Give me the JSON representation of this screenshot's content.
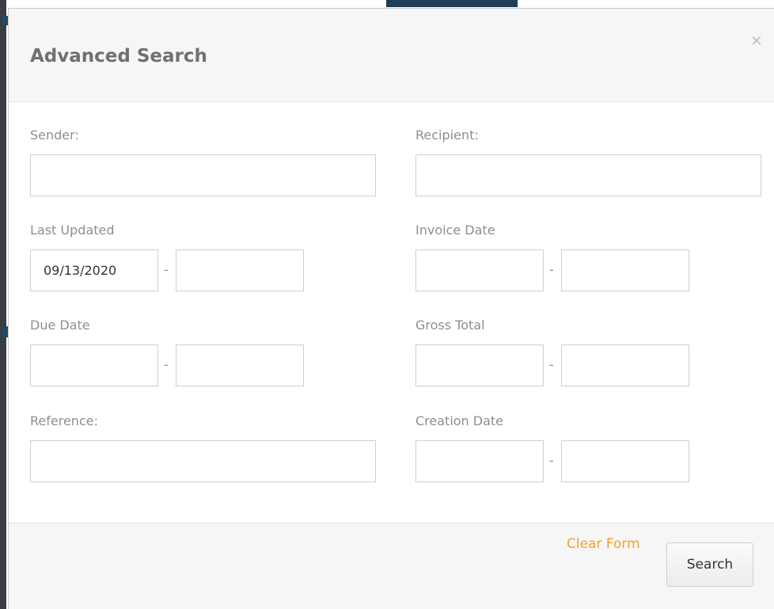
{
  "modal": {
    "title": "Advanced Search",
    "close_glyph": "×"
  },
  "fields": {
    "sender": {
      "label": "Sender:",
      "value": ""
    },
    "recipient": {
      "label": "Recipient:",
      "value": ""
    },
    "last_updated": {
      "label": "Last Updated",
      "from": "09/13/2020",
      "to": ""
    },
    "invoice_date": {
      "label": "Invoice Date",
      "from": "",
      "to": ""
    },
    "due_date": {
      "label": "Due Date",
      "from": "",
      "to": ""
    },
    "gross_total": {
      "label": "Gross Total",
      "from": "",
      "to": ""
    },
    "reference": {
      "label": "Reference:",
      "value": ""
    },
    "creation_date": {
      "label": "Creation Date",
      "from": "",
      "to": ""
    },
    "range_separator": "-"
  },
  "footer": {
    "clear_label": "Clear Form",
    "search_label": "Search"
  },
  "colors": {
    "link": "#f2a12a",
    "header_bg": "#f6f6f6",
    "label": "#8e8e8e"
  }
}
